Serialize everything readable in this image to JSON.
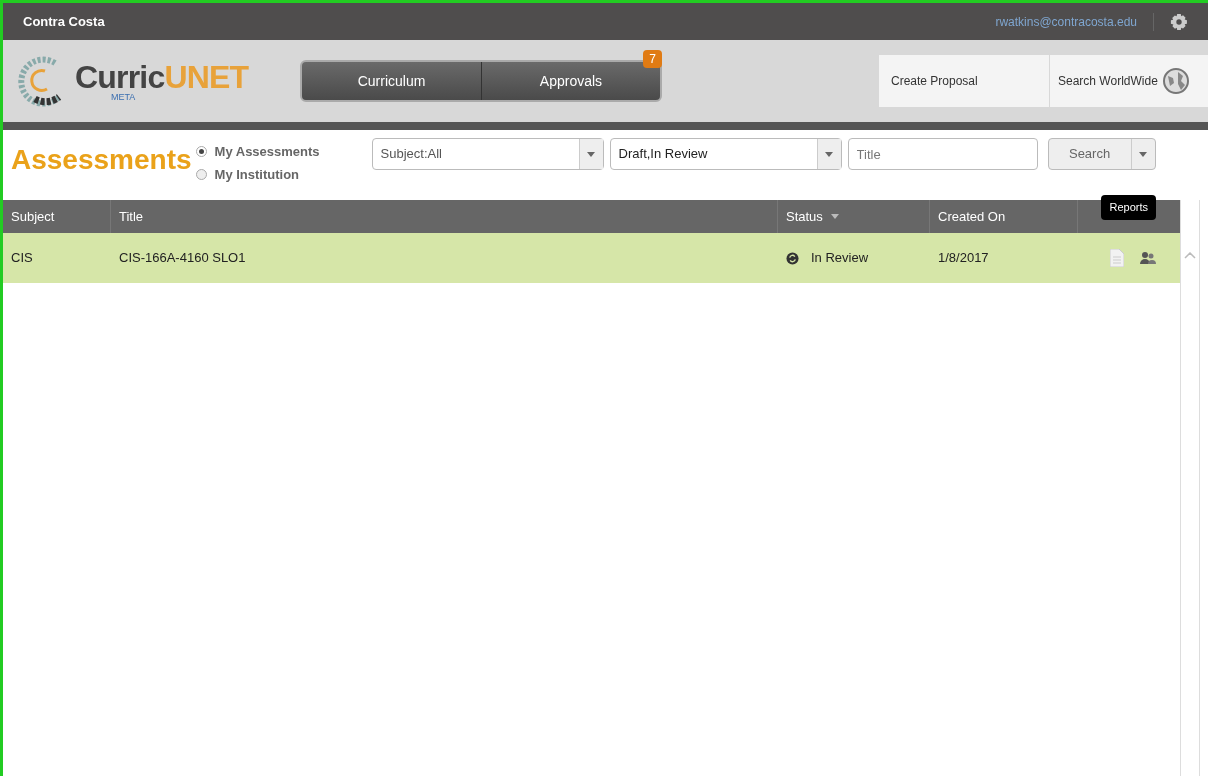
{
  "top_bar": {
    "institution": "Contra Costa",
    "user_email": "rwatkins@contracosta.edu"
  },
  "logo": {
    "name_start": "Curric",
    "name_highlight": "UNET",
    "subtitle": "META"
  },
  "nav": [
    {
      "label": "Curriculum"
    },
    {
      "label": "Approvals",
      "badge": "7"
    }
  ],
  "actions": [
    {
      "label": "Create Proposal",
      "kind": "plain"
    },
    {
      "label": "Search WorldWide",
      "kind": "globe"
    }
  ],
  "page_title": "Assessments",
  "scope": [
    {
      "label": "My Assessments",
      "selected": true
    },
    {
      "label": "My Institution",
      "selected": false
    }
  ],
  "filters": {
    "subject": "Subject:All",
    "status": "Draft,In Review",
    "title_placeholder": "Title",
    "search": "Search"
  },
  "table": {
    "columns": [
      "Subject",
      "Title",
      "Status",
      "Created On"
    ],
    "rows": [
      {
        "subject": "CIS",
        "title": "CIS-166A-4160 SLO1",
        "status": "In Review",
        "created_on": "1/8/2017",
        "selected": true
      }
    ]
  },
  "tooltip": "Reports"
}
